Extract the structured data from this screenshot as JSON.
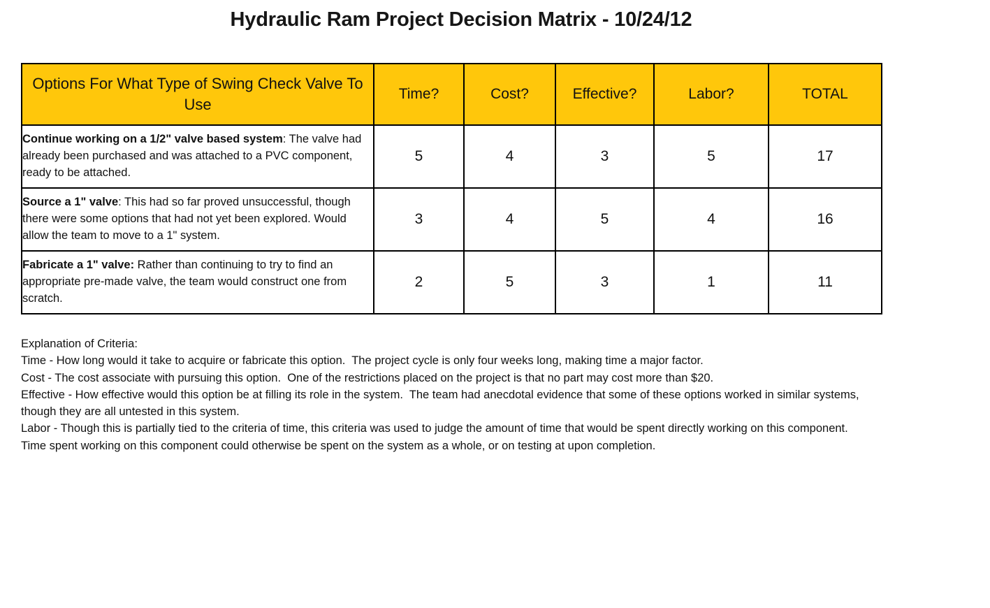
{
  "title": "Hydraulic Ram Project Decision Matrix - 10/24/12",
  "theme": {
    "header_fill": "#FFC70B",
    "border_color": "#000000",
    "text_color": "#121212",
    "page_background": "#FFFFFF"
  },
  "table": {
    "columns": [
      {
        "key": "option",
        "label": "Options For What Type of Swing Check Valve To Use"
      },
      {
        "key": "time",
        "label": "Time?"
      },
      {
        "key": "cost",
        "label": "Cost?"
      },
      {
        "key": "effective",
        "label": "Effective?"
      },
      {
        "key": "labor",
        "label": "Labor?"
      },
      {
        "key": "total",
        "label": "TOTAL"
      }
    ],
    "rows": [
      {
        "option_lead": "Continue working on a 1/2\" valve based system",
        "option_rest": ":  The valve had already been purchased and was attached to a PVC component, ready to be attached.",
        "time": "5",
        "cost": "4",
        "effective": "3",
        "labor": "5",
        "total": "17"
      },
      {
        "option_lead": "Source a 1\" valve",
        "option_rest": ": This had so far proved unsuccessful, though there were some options that had not yet been explored.  Would allow the team to move to a 1\" system.",
        "time": "3",
        "cost": "4",
        "effective": "5",
        "labor": "4",
        "total": "16"
      },
      {
        "option_lead": "Fabricate a 1\" valve:",
        "option_rest": " Rather than continuing to try to find an appropriate pre-made valve, the team would construct one from scratch.",
        "time": "2",
        "cost": "5",
        "effective": "3",
        "labor": "1",
        "total": "11"
      }
    ]
  },
  "explanation": {
    "heading": "Explanation of Criteria:",
    "lines": [
      "Time - How long would it take to acquire or fabricate this option.  The project cycle is only four weeks long, making time a major factor.",
      "Cost - The cost associate with pursuing this option.  One of the restrictions placed on the project is that no part may cost more than $20.",
      "Effective - How effective would this option be at filling its role in the system.  The team had anecdotal evidence that some of these options worked in similar systems, though they are all untested in this system.",
      "Labor - Though this is partially tied to the criteria of time, this criteria was used to judge the amount of time that would be spent directly working on this component.  Time spent working on this component could otherwise be spent on the system as a whole, or on testing at upon completion."
    ]
  }
}
